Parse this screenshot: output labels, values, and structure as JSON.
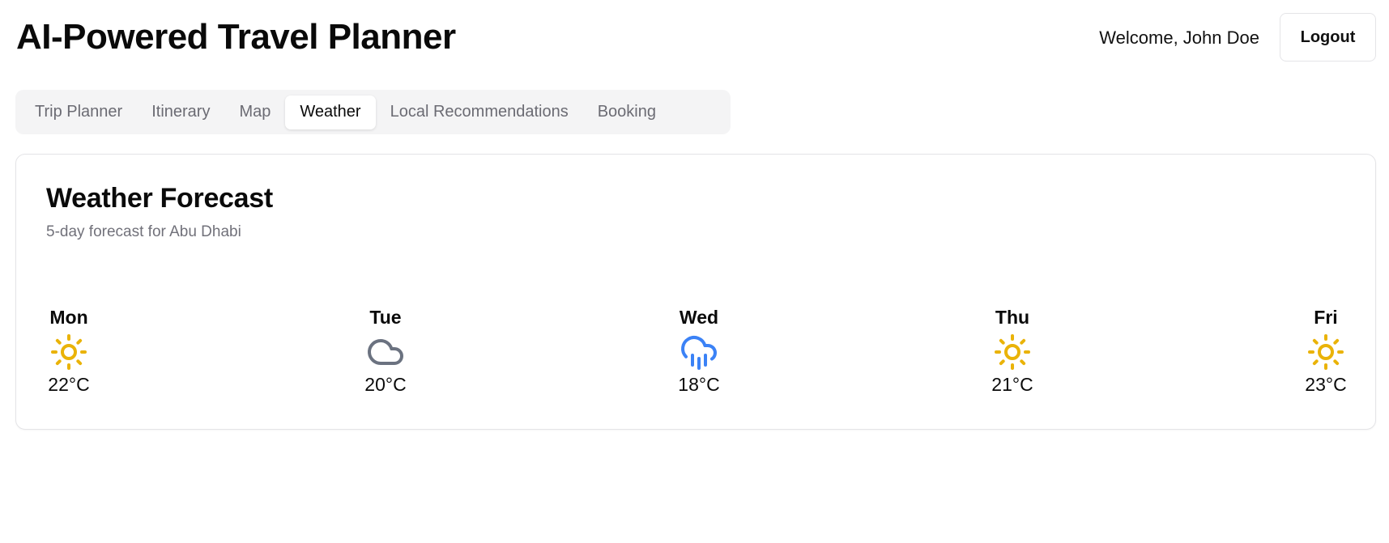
{
  "header": {
    "title": "AI-Powered Travel Planner",
    "welcome": "Welcome, John Doe",
    "logout_label": "Logout"
  },
  "tabs": [
    {
      "label": "Trip Planner",
      "active": false
    },
    {
      "label": "Itinerary",
      "active": false
    },
    {
      "label": "Map",
      "active": false
    },
    {
      "label": "Weather",
      "active": true
    },
    {
      "label": "Local Recommendations",
      "active": false
    },
    {
      "label": "Booking",
      "active": false
    }
  ],
  "weather": {
    "title": "Weather Forecast",
    "subtitle": "5-day forecast for Abu Dhabi",
    "days": [
      {
        "day": "Mon",
        "icon": "sun-icon",
        "temp": "22°C"
      },
      {
        "day": "Tue",
        "icon": "cloud-icon",
        "temp": "20°C"
      },
      {
        "day": "Wed",
        "icon": "cloud-rain-icon",
        "temp": "18°C"
      },
      {
        "day": "Thu",
        "icon": "sun-icon",
        "temp": "21°C"
      },
      {
        "day": "Fri",
        "icon": "sun-icon",
        "temp": "23°C"
      }
    ]
  },
  "colors": {
    "sun": "#eab308",
    "cloud": "#6b7280",
    "rain": "#3b82f6"
  }
}
